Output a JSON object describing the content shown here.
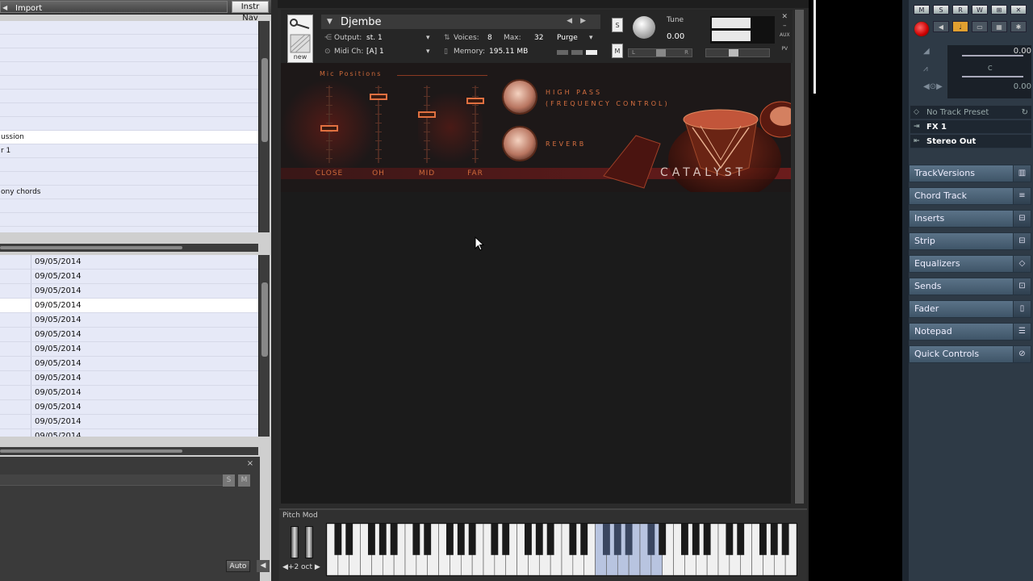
{
  "browser": {
    "import_label": "Import",
    "instr_nav_label": "Instr Nav",
    "list_rows": [
      "",
      "",
      "",
      "",
      "",
      "",
      "",
      "",
      "ussion",
      "r 1",
      "",
      "",
      "ony chords",
      "",
      ""
    ],
    "selected_list_index": 8,
    "date_rows": [
      "09/05/2014",
      "09/05/2014",
      "09/05/2014",
      "09/05/2014",
      "09/05/2014",
      "09/05/2014",
      "09/05/2014",
      "09/05/2014",
      "09/05/2014",
      "09/05/2014",
      "09/05/2014",
      "09/05/2014",
      "09/05/2014"
    ],
    "selected_date_index": 3,
    "solo_label": "S",
    "mute_label": "M",
    "close_glyph": "×",
    "auto_label": "Auto"
  },
  "kontakt": {
    "instrument_name": "Djembe",
    "output_label": "Output:",
    "output_value": "st. 1",
    "midi_label": "Midi Ch:",
    "midi_value": "[A]  1",
    "voices_label": "Voices:",
    "voices_value": "8",
    "max_label": "Max:",
    "max_value": "32",
    "purge_label": "Purge",
    "memory_label": "Memory:",
    "memory_value": "195.11 MB",
    "new_label": "new",
    "solo_label": "S",
    "mute_label": "M",
    "tune_label": "Tune",
    "tune_value": "0.00",
    "aux_label": "AUX",
    "pv_label": "PV",
    "pan_l": "L",
    "pan_r": "R",
    "mic_positions_title": "Mic Positions",
    "mic_channels": [
      {
        "label": "CLOSE",
        "level": 0.45
      },
      {
        "label": "OH",
        "level": 0.85
      },
      {
        "label": "MID",
        "level": 0.63
      },
      {
        "label": "FAR",
        "level": 0.8
      }
    ],
    "high_pass_label": "HIGH PASS",
    "high_pass_sub": "(FREQUENCY CONTROL)",
    "reverb_label": "REVERB",
    "library_name": "CATALYST",
    "pitch_mod_label": "Pitch Mod",
    "octave_label": "+2 oct"
  },
  "inspector": {
    "toolbar_buttons": [
      "M",
      "S",
      "R",
      "W",
      "⊞",
      "✕"
    ],
    "volume_value": "0.00",
    "pan_value": "C",
    "delay_value": "0.00",
    "preset_label": "No Track Preset",
    "fx_label": "FX 1",
    "output_label": "Stereo Out",
    "sections": [
      {
        "label": "TrackVersions",
        "icon": "versions-icon",
        "glyph": "▥"
      },
      {
        "label": "Chord Track",
        "icon": "chord-icon",
        "glyph": "≡"
      },
      {
        "label": "Inserts",
        "icon": "insert-icon",
        "glyph": "⊟"
      },
      {
        "label": "Strip",
        "icon": "strip-icon",
        "glyph": "⊟"
      },
      {
        "label": "Equalizers",
        "icon": "eq-icon",
        "glyph": "◇"
      },
      {
        "label": "Sends",
        "icon": "sends-icon",
        "glyph": "⊡"
      },
      {
        "label": "Fader",
        "icon": "fader-icon",
        "glyph": "▯"
      },
      {
        "label": "Notepad",
        "icon": "notepad-icon",
        "glyph": "☰"
      },
      {
        "label": "Quick Controls",
        "icon": "quick-controls-icon",
        "glyph": "⊘"
      }
    ]
  }
}
